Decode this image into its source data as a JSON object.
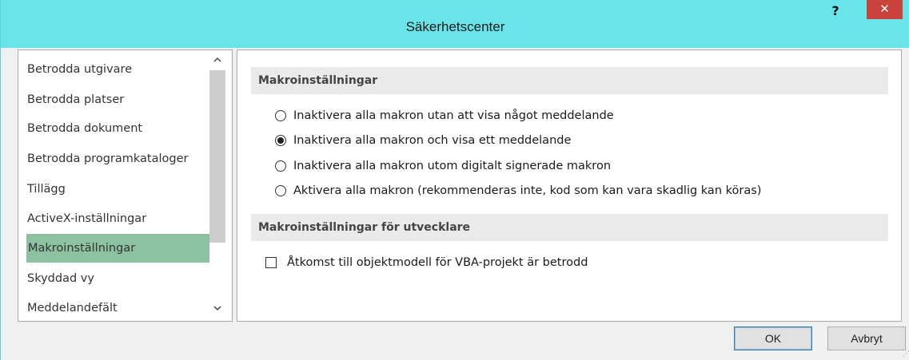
{
  "window": {
    "title": "Säkerhetscenter",
    "help_label": "?",
    "close_label": "✕"
  },
  "nav": {
    "items": [
      {
        "label": "Betrodda utgivare"
      },
      {
        "label": "Betrodda platser"
      },
      {
        "label": "Betrodda dokument"
      },
      {
        "label": "Betrodda programkataloger"
      },
      {
        "label": "Tillägg"
      },
      {
        "label": "ActiveX-inställningar"
      },
      {
        "label": "Makroinställningar"
      },
      {
        "label": "Skyddad vy"
      },
      {
        "label": "Meddelandefält"
      }
    ],
    "selected_index": 6,
    "scroll_up_label": "^",
    "scroll_down_label": "v"
  },
  "macro_settings": {
    "header": "Makroinställningar",
    "options": [
      {
        "label": "Inaktivera alla makron utan att visa något meddelande",
        "checked": false
      },
      {
        "label": "Inaktivera alla makron och visa ett meddelande",
        "checked": true
      },
      {
        "label": "Inaktivera alla makron utom digitalt signerade makron",
        "checked": false
      },
      {
        "label": "Aktivera alla makron (rekommenderas inte, kod som kan vara skadlig kan köras)",
        "checked": false
      }
    ]
  },
  "developer_settings": {
    "header": "Makroinställningar för utvecklare",
    "vba_label": "Åtkomst till objektmodell för VBA-projekt är betrodd",
    "vba_checked": false
  },
  "buttons": {
    "ok_label": "OK",
    "cancel_label": "Avbryt"
  },
  "colors": {
    "titlebar": "#69e5ea",
    "close": "#c9423b",
    "selected_item": "#8cc2a0"
  }
}
